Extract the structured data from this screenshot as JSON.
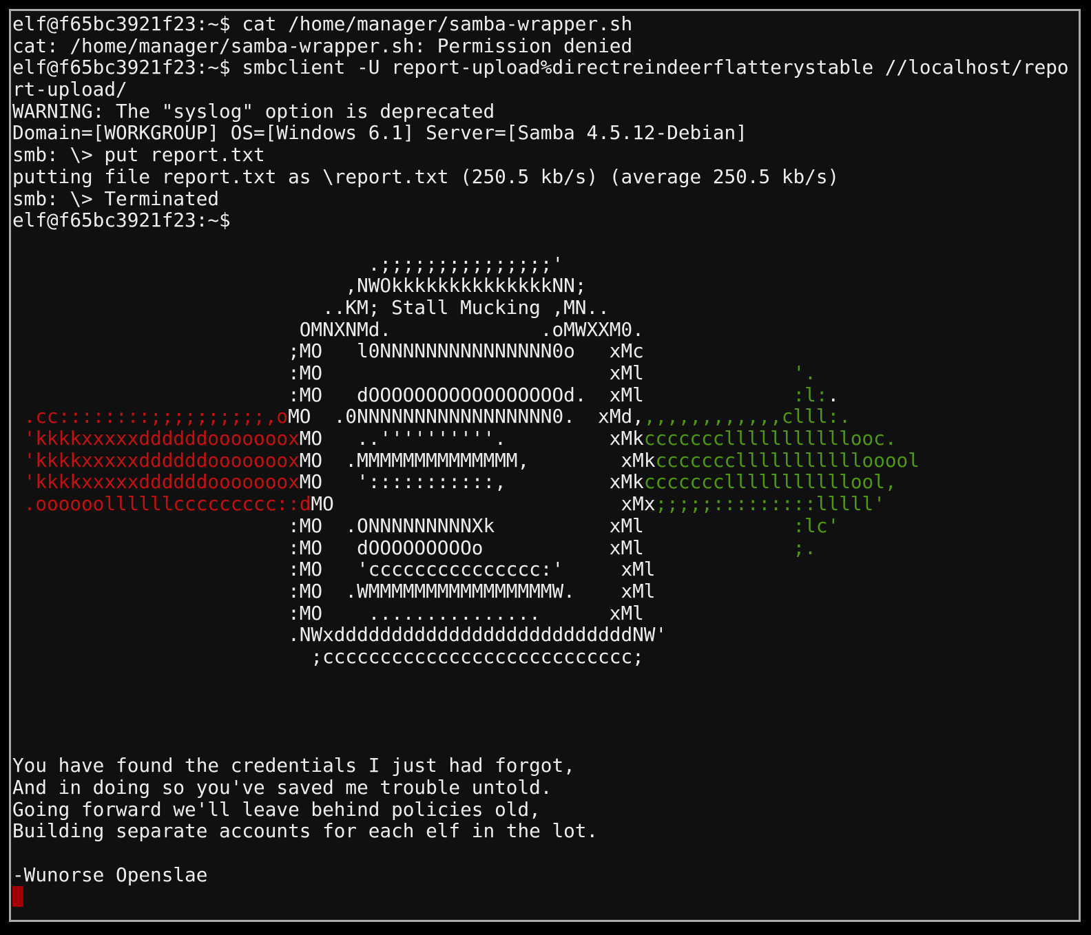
{
  "terminal": {
    "colors": {
      "background": "#101010",
      "text": "#ededed",
      "red": "#c80f0f",
      "green": "#4f9a0b",
      "cursor": "#a00000",
      "border": "#a9a9a9"
    },
    "lines": [
      [
        {
          "t": "elf@f65bc3921f23:~$ cat /home/manager/samba-wrapper.sh",
          "c": "white"
        }
      ],
      [
        {
          "t": "cat: /home/manager/samba-wrapper.sh: Permission denied",
          "c": "white"
        }
      ],
      [
        {
          "t": "elf@f65bc3921f23:~$ smbclient -U report-upload%directreindeerflatterystable //localhost/repo",
          "c": "white"
        }
      ],
      [
        {
          "t": "rt-upload/",
          "c": "white"
        }
      ],
      [
        {
          "t": "WARNING: The \"syslog\" option is deprecated",
          "c": "white"
        }
      ],
      [
        {
          "t": "Domain=[WORKGROUP] OS=[Windows 6.1] Server=[Samba 4.5.12-Debian]",
          "c": "white"
        }
      ],
      [
        {
          "t": "smb: \\> put report.txt",
          "c": "white"
        }
      ],
      [
        {
          "t": "putting file report.txt as \\report.txt (250.5 kb/s) (average 250.5 kb/s)",
          "c": "white"
        }
      ],
      [
        {
          "t": "smb: \\> Terminated",
          "c": "white"
        }
      ],
      [
        {
          "t": "elf@f65bc3921f23:~$",
          "c": "white"
        }
      ],
      [
        {
          "t": "",
          "c": "white"
        }
      ],
      [
        {
          "t": "                               .;;;;;;;;;;;;;;;'",
          "c": "white"
        }
      ],
      [
        {
          "t": "                             ,NWOkkkkkkkkkkkkkkNN;",
          "c": "white"
        }
      ],
      [
        {
          "t": "                           ..KM; Stall Mucking ,MN..",
          "c": "white"
        }
      ],
      [
        {
          "t": "                         OMNXNMd.             .oMWXXM0.",
          "c": "white"
        }
      ],
      [
        {
          "t": "                        ;MO   l0NNNNNNNNNNNNNNN0o   xMc",
          "c": "white"
        }
      ],
      [
        {
          "t": "                        :MO                         xMl",
          "c": "white"
        },
        {
          "t": "             '.",
          "c": "green"
        }
      ],
      [
        {
          "t": "                        :MO   dOOOOOOOOOOOOOOOOOd.  xMl",
          "c": "white"
        },
        {
          "t": "             :l:",
          "c": "green"
        },
        {
          "t": ".",
          "c": "white"
        }
      ],
      [
        {
          "t": " .cc::::::::;;;;;;;;;;,o",
          "c": "red"
        },
        {
          "t": "MO  .0NNNNNNNNNNNNNNNNN0.  xMd,",
          "c": "white"
        },
        {
          "t": ",,,,,,,,,,,,clll:.",
          "c": "green"
        }
      ],
      [
        {
          "t": " 'kkkkxxxxxddddddooooooox",
          "c": "red"
        },
        {
          "t": "MO   ..''''''''''.         xMk",
          "c": "white"
        },
        {
          "t": "ccccccclllllllllllooc.",
          "c": "green"
        }
      ],
      [
        {
          "t": " 'kkkkxxxxxddddddooooooox",
          "c": "red"
        },
        {
          "t": "MO  .MMMMMMMMMMMMMM,        xMk",
          "c": "white"
        },
        {
          "t": "ccccccclllllllllllooool",
          "c": "green"
        }
      ],
      [
        {
          "t": " 'kkkkxxxxxddddddooooooox",
          "c": "red"
        },
        {
          "t": "MO   ':::::::::::,         xMk",
          "c": "white"
        },
        {
          "t": "ccccccclllllllllllool,",
          "c": "green"
        }
      ],
      [
        {
          "t": " .oooooollllllccccccccc::d",
          "c": "red"
        },
        {
          "t": "MO                         xMx",
          "c": "white"
        },
        {
          "t": ";;;;;:::::::::lllll'",
          "c": "green"
        }
      ],
      [
        {
          "t": "                        :MO  .ONNNNNNNNNXk          xMl",
          "c": "white"
        },
        {
          "t": "             :lc'",
          "c": "green"
        }
      ],
      [
        {
          "t": "                        :MO   dOOOOOOOOOo           xMl",
          "c": "white"
        },
        {
          "t": "             ;.",
          "c": "green"
        }
      ],
      [
        {
          "t": "                        :MO   'ccccccccccccccc:'     xMl",
          "c": "white"
        }
      ],
      [
        {
          "t": "                        :MO  .WMMMMMMMMMMMMMMMMW.    xMl",
          "c": "white"
        }
      ],
      [
        {
          "t": "                        :MO    ...............      xMl",
          "c": "white"
        }
      ],
      [
        {
          "t": "                        .NWxddddddddddddddddddddddddddNW'",
          "c": "white"
        }
      ],
      [
        {
          "t": "                          ;ccccccccccccccccccccccccccc;",
          "c": "white"
        }
      ],
      [
        {
          "t": "",
          "c": "white"
        }
      ],
      [
        {
          "t": "",
          "c": "white"
        }
      ],
      [
        {
          "t": "",
          "c": "white"
        }
      ],
      [
        {
          "t": "",
          "c": "white"
        }
      ],
      [
        {
          "t": "You have found the credentials I just had forgot,",
          "c": "white"
        }
      ],
      [
        {
          "t": "And in doing so you've saved me trouble untold.",
          "c": "white"
        }
      ],
      [
        {
          "t": "Going forward we'll leave behind policies old,",
          "c": "white"
        }
      ],
      [
        {
          "t": "Building separate accounts for each elf in the lot.",
          "c": "white"
        }
      ],
      [
        {
          "t": "",
          "c": "white"
        }
      ],
      [
        {
          "t": "-Wunorse Openslae",
          "c": "white"
        }
      ]
    ]
  }
}
